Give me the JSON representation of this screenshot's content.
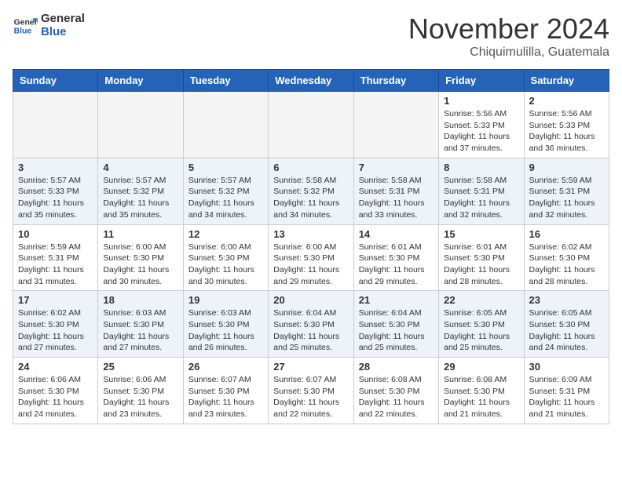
{
  "header": {
    "logo_general": "General",
    "logo_blue": "Blue",
    "month_year": "November 2024",
    "location": "Chiquimulilla, Guatemala"
  },
  "days_of_week": [
    "Sunday",
    "Monday",
    "Tuesday",
    "Wednesday",
    "Thursday",
    "Friday",
    "Saturday"
  ],
  "weeks": [
    [
      {
        "day": "",
        "info": "",
        "empty": true
      },
      {
        "day": "",
        "info": "",
        "empty": true
      },
      {
        "day": "",
        "info": "",
        "empty": true
      },
      {
        "day": "",
        "info": "",
        "empty": true
      },
      {
        "day": "",
        "info": "",
        "empty": true
      },
      {
        "day": "1",
        "info": "Sunrise: 5:56 AM\nSunset: 5:33 PM\nDaylight: 11 hours\nand 37 minutes."
      },
      {
        "day": "2",
        "info": "Sunrise: 5:56 AM\nSunset: 5:33 PM\nDaylight: 11 hours\nand 36 minutes."
      }
    ],
    [
      {
        "day": "3",
        "info": "Sunrise: 5:57 AM\nSunset: 5:33 PM\nDaylight: 11 hours\nand 35 minutes."
      },
      {
        "day": "4",
        "info": "Sunrise: 5:57 AM\nSunset: 5:32 PM\nDaylight: 11 hours\nand 35 minutes."
      },
      {
        "day": "5",
        "info": "Sunrise: 5:57 AM\nSunset: 5:32 PM\nDaylight: 11 hours\nand 34 minutes."
      },
      {
        "day": "6",
        "info": "Sunrise: 5:58 AM\nSunset: 5:32 PM\nDaylight: 11 hours\nand 34 minutes."
      },
      {
        "day": "7",
        "info": "Sunrise: 5:58 AM\nSunset: 5:31 PM\nDaylight: 11 hours\nand 33 minutes."
      },
      {
        "day": "8",
        "info": "Sunrise: 5:58 AM\nSunset: 5:31 PM\nDaylight: 11 hours\nand 32 minutes."
      },
      {
        "day": "9",
        "info": "Sunrise: 5:59 AM\nSunset: 5:31 PM\nDaylight: 11 hours\nand 32 minutes."
      }
    ],
    [
      {
        "day": "10",
        "info": "Sunrise: 5:59 AM\nSunset: 5:31 PM\nDaylight: 11 hours\nand 31 minutes."
      },
      {
        "day": "11",
        "info": "Sunrise: 6:00 AM\nSunset: 5:30 PM\nDaylight: 11 hours\nand 30 minutes."
      },
      {
        "day": "12",
        "info": "Sunrise: 6:00 AM\nSunset: 5:30 PM\nDaylight: 11 hours\nand 30 minutes."
      },
      {
        "day": "13",
        "info": "Sunrise: 6:00 AM\nSunset: 5:30 PM\nDaylight: 11 hours\nand 29 minutes."
      },
      {
        "day": "14",
        "info": "Sunrise: 6:01 AM\nSunset: 5:30 PM\nDaylight: 11 hours\nand 29 minutes."
      },
      {
        "day": "15",
        "info": "Sunrise: 6:01 AM\nSunset: 5:30 PM\nDaylight: 11 hours\nand 28 minutes."
      },
      {
        "day": "16",
        "info": "Sunrise: 6:02 AM\nSunset: 5:30 PM\nDaylight: 11 hours\nand 28 minutes."
      }
    ],
    [
      {
        "day": "17",
        "info": "Sunrise: 6:02 AM\nSunset: 5:30 PM\nDaylight: 11 hours\nand 27 minutes."
      },
      {
        "day": "18",
        "info": "Sunrise: 6:03 AM\nSunset: 5:30 PM\nDaylight: 11 hours\nand 27 minutes."
      },
      {
        "day": "19",
        "info": "Sunrise: 6:03 AM\nSunset: 5:30 PM\nDaylight: 11 hours\nand 26 minutes."
      },
      {
        "day": "20",
        "info": "Sunrise: 6:04 AM\nSunset: 5:30 PM\nDaylight: 11 hours\nand 25 minutes."
      },
      {
        "day": "21",
        "info": "Sunrise: 6:04 AM\nSunset: 5:30 PM\nDaylight: 11 hours\nand 25 minutes."
      },
      {
        "day": "22",
        "info": "Sunrise: 6:05 AM\nSunset: 5:30 PM\nDaylight: 11 hours\nand 25 minutes."
      },
      {
        "day": "23",
        "info": "Sunrise: 6:05 AM\nSunset: 5:30 PM\nDaylight: 11 hours\nand 24 minutes."
      }
    ],
    [
      {
        "day": "24",
        "info": "Sunrise: 6:06 AM\nSunset: 5:30 PM\nDaylight: 11 hours\nand 24 minutes."
      },
      {
        "day": "25",
        "info": "Sunrise: 6:06 AM\nSunset: 5:30 PM\nDaylight: 11 hours\nand 23 minutes."
      },
      {
        "day": "26",
        "info": "Sunrise: 6:07 AM\nSunset: 5:30 PM\nDaylight: 11 hours\nand 23 minutes."
      },
      {
        "day": "27",
        "info": "Sunrise: 6:07 AM\nSunset: 5:30 PM\nDaylight: 11 hours\nand 22 minutes."
      },
      {
        "day": "28",
        "info": "Sunrise: 6:08 AM\nSunset: 5:30 PM\nDaylight: 11 hours\nand 22 minutes."
      },
      {
        "day": "29",
        "info": "Sunrise: 6:08 AM\nSunset: 5:30 PM\nDaylight: 11 hours\nand 21 minutes."
      },
      {
        "day": "30",
        "info": "Sunrise: 6:09 AM\nSunset: 5:31 PM\nDaylight: 11 hours\nand 21 minutes."
      }
    ]
  ]
}
